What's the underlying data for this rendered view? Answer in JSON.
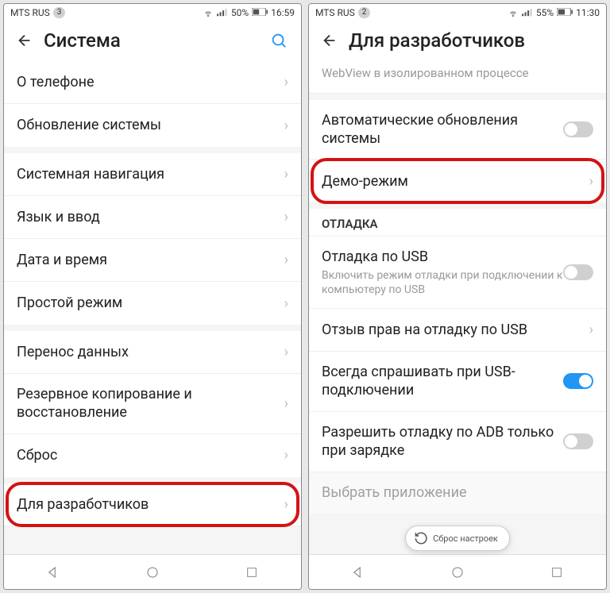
{
  "left": {
    "statusbar": {
      "carrier": "MTS RUS",
      "sim": "3",
      "battery": "50%",
      "time": "16:59"
    },
    "header": {
      "title": "Система"
    },
    "rows": [
      {
        "title": "О телефоне"
      },
      {
        "title": "Обновление системы"
      },
      {
        "title": "Системная навигация"
      },
      {
        "title": "Язык и ввод"
      },
      {
        "title": "Дата и время"
      },
      {
        "title": "Простой режим"
      },
      {
        "title": "Перенос данных"
      },
      {
        "title": "Резервное копирование и восстановление"
      },
      {
        "title": "Сброс"
      },
      {
        "title": "Для разработчиков"
      }
    ]
  },
  "right": {
    "statusbar": {
      "carrier": "MTS RUS",
      "sim": "2",
      "battery": "55%",
      "time": "11:30"
    },
    "header": {
      "title": "Для разработчиков"
    },
    "partial_top": "WebView в изолированном процессе",
    "rows": {
      "auto_update": "Автоматические обновления системы",
      "demo": "Демо-режим",
      "section": "ОТЛАДКА",
      "usb_debug_title": "Отладка по USB",
      "usb_debug_sub": "Включить режим отладки при подключении к компьютеру по USB",
      "revoke": "Отзыв прав на отладку по USB",
      "always_ask": "Всегда спрашивать при USB-подключении",
      "adb_charging": "Разрешить отладку по ADB только при зарядке",
      "select_app": "Выбрать приложение"
    },
    "tooltip": "Сброс настроек"
  }
}
